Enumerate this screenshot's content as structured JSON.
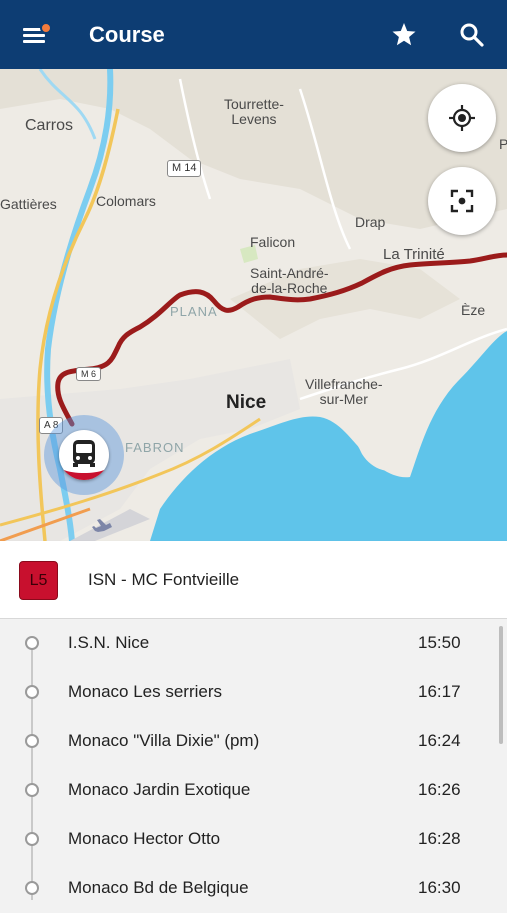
{
  "header": {
    "title": "Course",
    "menu_icon": "hamburger-menu-icon",
    "favorite_icon": "star-icon",
    "search_icon": "search-icon",
    "notification_color": "#f37b3c",
    "bar_color": "#0d3d73"
  },
  "map": {
    "labels": {
      "tourrette": "Tourrette-\nLevens",
      "carros": "Carros",
      "gattieres": "Gattières",
      "colomars": "Colomars",
      "drap": "Drap",
      "falicon": "Falicon",
      "la_trinite": "La Trinité",
      "saint_andre": "Saint-André-\nde-la-Roche",
      "eze": "Èze",
      "plana": "PLANA",
      "nice": "Nice",
      "villefranche": "Villefranche-\nsur-Mer",
      "fabron": "FABRON",
      "edge_p": "P"
    },
    "road_badges": {
      "m14": "M 14",
      "m6": "M 6",
      "a8": "A 8"
    },
    "locate_icon": "my-location-icon",
    "recenter_icon": "focus-frame-icon",
    "bus_icon": "bus-icon",
    "route_color": "#9b1b1b",
    "sea_color": "#5fc4ea"
  },
  "route": {
    "line_label": "L5",
    "name": "ISN - MC Fontvieille",
    "line_color": "#c8102e"
  },
  "stops": [
    {
      "name": "I.S.N. Nice",
      "time": "15:50"
    },
    {
      "name": "Monaco Les serriers",
      "time": "16:17"
    },
    {
      "name": "Monaco \"Villa Dixie\" (pm)",
      "time": "16:24"
    },
    {
      "name": "Monaco Jardin Exotique",
      "time": "16:26"
    },
    {
      "name": "Monaco Hector Otto",
      "time": "16:28"
    },
    {
      "name": "Monaco Bd de Belgique",
      "time": "16:30"
    }
  ]
}
